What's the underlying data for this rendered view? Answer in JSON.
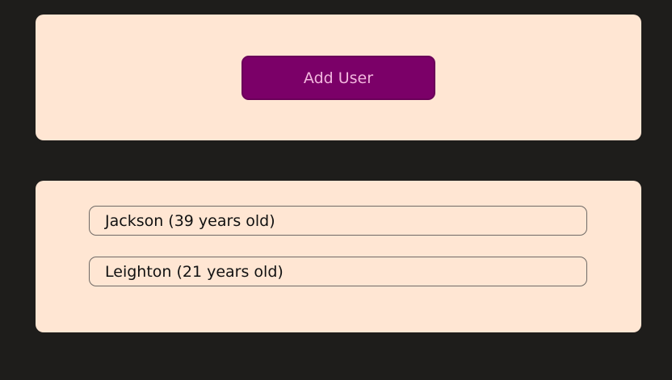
{
  "actions": {
    "add_user_label": "Add User"
  },
  "users": [
    {
      "text": "Jackson (39 years old)"
    },
    {
      "text": "Leighton (21 years old)"
    }
  ],
  "colors": {
    "page_background": "#1e1d1b",
    "card_background": "#ffe6d3",
    "button_background": "#7b0068",
    "button_text": "#f3b7df",
    "item_border": "#6f6a66"
  }
}
